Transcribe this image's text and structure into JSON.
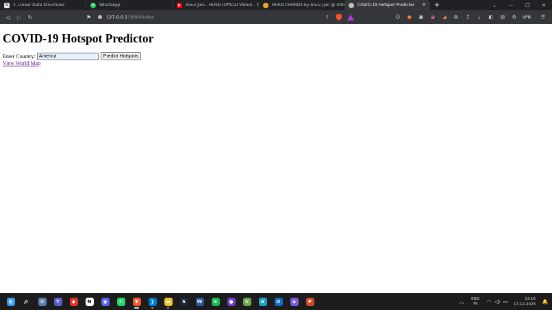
{
  "browser": {
    "tabs": [
      {
        "title": "2. Linear Data Structures",
        "icon": "notion-icon",
        "color": "#e8e8e8"
      },
      {
        "title": "WhatsApp",
        "icon": "whatsapp-icon",
        "color": "#25d366"
      },
      {
        "title": "Anuv Jain - HUSN (Official Video) - Yo",
        "icon": "youtube-icon",
        "color": "#ff0000"
      },
      {
        "title": "HUSN CHORDS by Anuv Jain @ Ultim",
        "icon": "ultimate-guitar-icon",
        "color": "#f5a623"
      },
      {
        "title": "COVID-19 Hotspot Predictor",
        "icon": "globe-icon",
        "color": "#bdbdbd",
        "active": true
      }
    ],
    "new_tab": "+",
    "url_host": "127.0.0.1",
    "url_path": ":5000/index",
    "vpn_label": "VPN"
  },
  "page": {
    "heading": "COVID-19 Hotspot Predictor",
    "country_label": "Enter Country:",
    "country_value": "America",
    "predict_button": "Predict Hotspots",
    "map_link": "View World Map"
  },
  "taskbar": {
    "apps": [
      {
        "name": "windows-start",
        "color": "#3a9bf5",
        "glyph": "⊞"
      },
      {
        "name": "search",
        "color": "#1c1c1c",
        "glyph": "⌕"
      },
      {
        "name": "settings",
        "color": "#5b7fb0",
        "glyph": "⚙"
      },
      {
        "name": "teams",
        "color": "#5b5fc7",
        "glyph": "T"
      },
      {
        "name": "app-red",
        "color": "#e5322d",
        "glyph": "◆"
      },
      {
        "name": "notion",
        "color": "#ffffff",
        "glyph": "N",
        "fg": "#000"
      },
      {
        "name": "discord",
        "color": "#5865f2",
        "glyph": "◉"
      },
      {
        "name": "whatsapp",
        "color": "#25d366",
        "glyph": "✆"
      },
      {
        "name": "brave",
        "color": "#fb542b",
        "glyph": "▼",
        "state": "active"
      },
      {
        "name": "vscode",
        "color": "#0078d4",
        "glyph": "❯",
        "state": "running"
      },
      {
        "name": "file-explorer",
        "color": "#f2c12e",
        "glyph": "▬",
        "state": "running"
      },
      {
        "name": "steam",
        "color": "#1b2838",
        "glyph": "S"
      },
      {
        "name": "word",
        "color": "#2b579a",
        "glyph": "W"
      },
      {
        "name": "spotify",
        "color": "#1db954",
        "glyph": "≋"
      },
      {
        "name": "github",
        "color": "#6e40c9",
        "glyph": "●"
      },
      {
        "name": "app-stack",
        "color": "#6aa84f",
        "glyph": "≡"
      },
      {
        "name": "edge",
        "color": "#1fa2c9",
        "glyph": "e"
      },
      {
        "name": "outlook",
        "color": "#0f6cbd",
        "glyph": "O"
      },
      {
        "name": "obsidian",
        "color": "#7c5cd6",
        "glyph": "◈"
      },
      {
        "name": "powerpoint",
        "color": "#d24726",
        "glyph": "P"
      }
    ],
    "lang_top": "ENG",
    "lang_bottom": "IN",
    "time": "13:16",
    "date": "17-12-2023"
  }
}
